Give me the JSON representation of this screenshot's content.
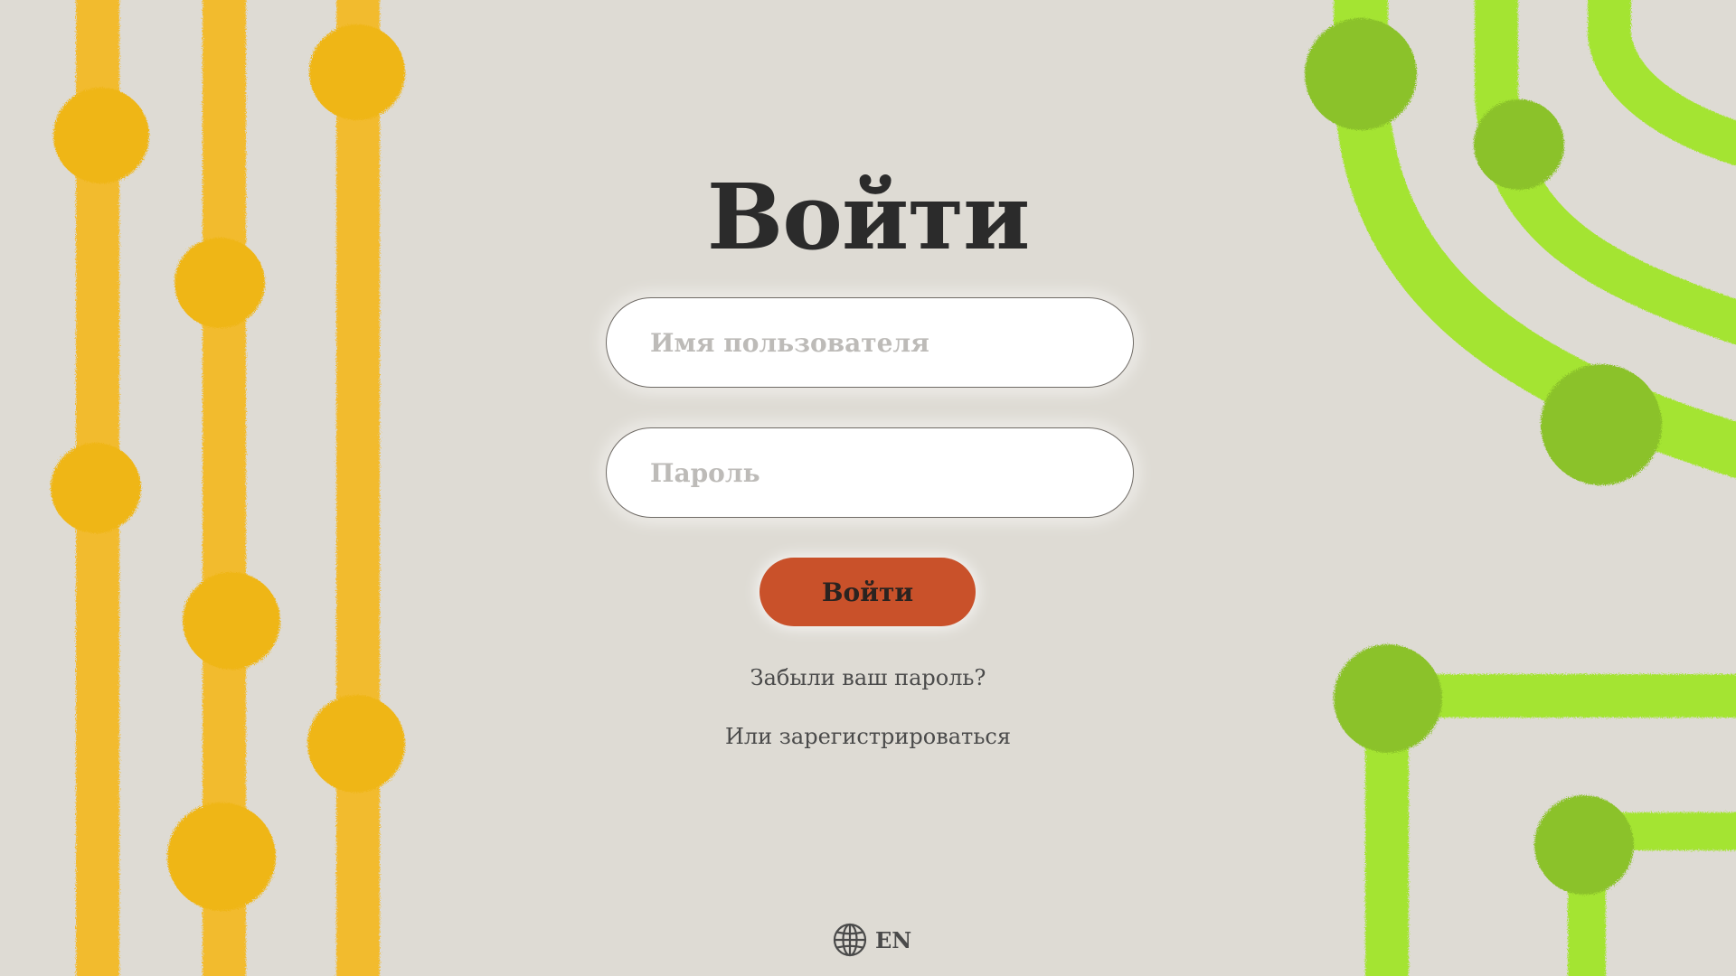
{
  "login": {
    "title": "Войти",
    "username_placeholder": "Имя пользователя",
    "password_placeholder": "Пароль",
    "submit_label": "Войти",
    "forgot_password_link": "Забыли ваш пароль?",
    "register_link": "Или зарегистрироваться"
  },
  "language": {
    "icon": "globe-icon",
    "label": "EN"
  },
  "colors": {
    "background": "#dedbd4",
    "submit_button": "#c9512a",
    "decor_yellow_line": "#f2bb2e",
    "decor_yellow_dot": "#efb619",
    "decor_green_line": "#a4e432",
    "decor_green_dot": "#8bc22b"
  }
}
